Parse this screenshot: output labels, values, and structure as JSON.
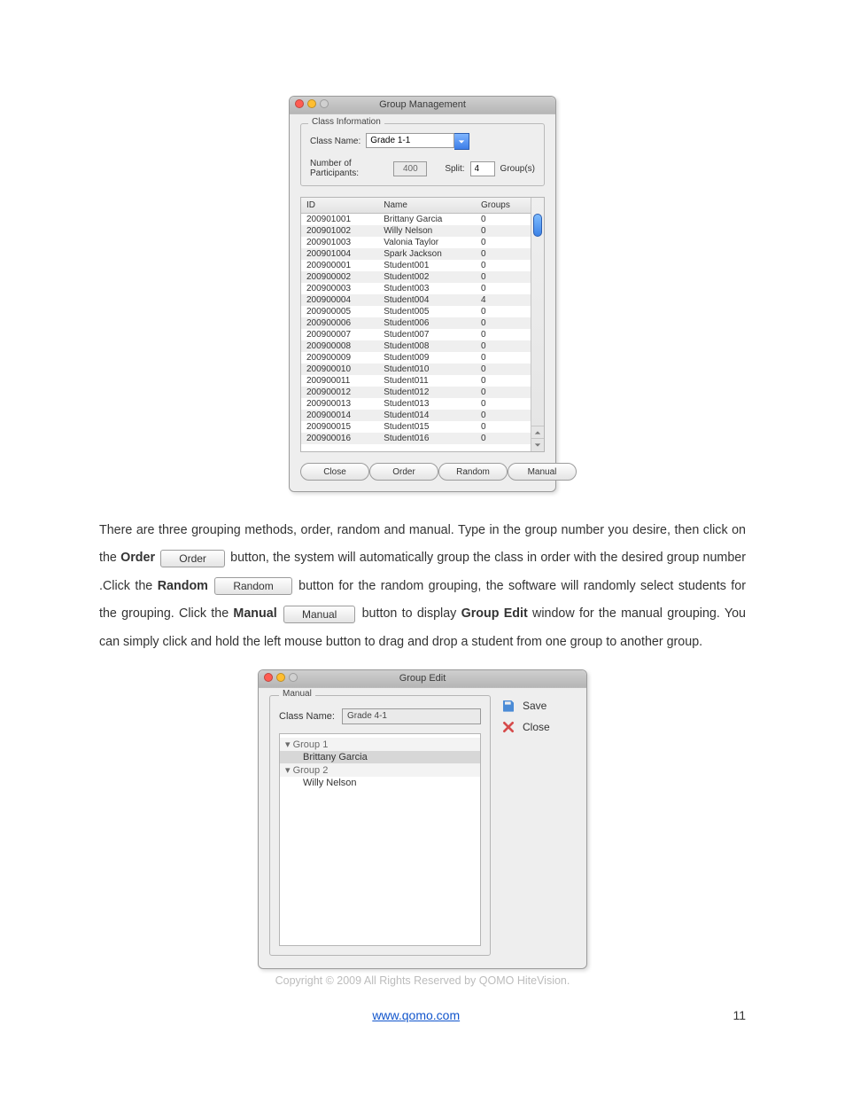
{
  "group_management": {
    "title": "Group Management",
    "fieldset_legend": "Class Information",
    "class_name_label": "Class Name:",
    "class_name_value": "Grade 1-1",
    "participants_label": "Number of Participants:",
    "participants_value": "400",
    "split_label": "Split:",
    "split_value": "4",
    "split_suffix": "Group(s)",
    "headers": {
      "id": "ID",
      "name": "Name",
      "groups": "Groups"
    },
    "rows": [
      {
        "id": "200901001",
        "name": "Brittany Garcia",
        "groups": "0"
      },
      {
        "id": "200901002",
        "name": "Willy Nelson",
        "groups": "0"
      },
      {
        "id": "200901003",
        "name": "Valonia Taylor",
        "groups": "0"
      },
      {
        "id": "200901004",
        "name": "Spark Jackson",
        "groups": "0"
      },
      {
        "id": "200900001",
        "name": "Student001",
        "groups": "0"
      },
      {
        "id": "200900002",
        "name": "Student002",
        "groups": "0"
      },
      {
        "id": "200900003",
        "name": "Student003",
        "groups": "0"
      },
      {
        "id": "200900004",
        "name": "Student004",
        "groups": "4"
      },
      {
        "id": "200900005",
        "name": "Student005",
        "groups": "0"
      },
      {
        "id": "200900006",
        "name": "Student006",
        "groups": "0"
      },
      {
        "id": "200900007",
        "name": "Student007",
        "groups": "0"
      },
      {
        "id": "200900008",
        "name": "Student008",
        "groups": "0"
      },
      {
        "id": "200900009",
        "name": "Student009",
        "groups": "0"
      },
      {
        "id": "200900010",
        "name": "Student010",
        "groups": "0"
      },
      {
        "id": "200900011",
        "name": "Student011",
        "groups": "0"
      },
      {
        "id": "200900012",
        "name": "Student012",
        "groups": "0"
      },
      {
        "id": "200900013",
        "name": "Student013",
        "groups": "0"
      },
      {
        "id": "200900014",
        "name": "Student014",
        "groups": "0"
      },
      {
        "id": "200900015",
        "name": "Student015",
        "groups": "0"
      },
      {
        "id": "200900016",
        "name": "Student016",
        "groups": "0"
      }
    ],
    "buttons": {
      "close": "Close",
      "order": "Order",
      "random": "Random",
      "manual": "Manual"
    }
  },
  "description": {
    "p1a": "There are three grouping methods, order, random and manual. Type in the group number you desire, then click on the ",
    "order_bold": "Order",
    "order_btn": "Order",
    "p1b": "button, the system will automatically group the class in order with the desired group number .Click the ",
    "random_bold": "Random",
    "random_btn": "Random",
    "p1c": " button for the random grouping, the software will randomly select students for the grouping. Click the ",
    "manual_bold": "Manual",
    "manual_btn": "Manual",
    "p1d": " button to display ",
    "groupedit_bold": "Group Edit",
    "p1e": " window for the manual grouping. You can simply click and hold the left mouse button to drag and drop a student from one group to another group."
  },
  "group_edit": {
    "title": "Group Edit",
    "legend": "Manual",
    "class_name_label": "Class Name:",
    "class_name_value": "Grade 4-1",
    "groups": [
      {
        "name": "Group 1",
        "members": [
          "Brittany Garcia"
        ]
      },
      {
        "name": "Group 2",
        "members": [
          "Willy Nelson"
        ]
      }
    ],
    "side": {
      "save": "Save",
      "close": "Close"
    }
  },
  "footer": {
    "copyright": "Copyright © 2009 All Rights Reserved by QOMO HiteVision.",
    "link": "www.qomo.com",
    "page": "11"
  }
}
